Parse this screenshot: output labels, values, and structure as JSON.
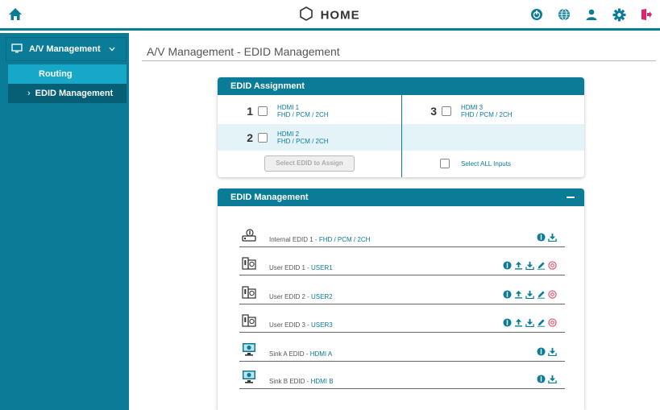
{
  "header": {
    "title": "HOME",
    "icons": [
      "home-icon",
      "power-icon",
      "globe-icon",
      "user-icon",
      "gear-icon",
      "logout-icon"
    ]
  },
  "sidebar": {
    "section_label": "A/V Management",
    "items": [
      {
        "label": "Routing",
        "active": false
      },
      {
        "label": "EDID Management",
        "active": true
      }
    ],
    "active_prefix": "›"
  },
  "main": {
    "breadcrumb": "A/V Management - EDID Management"
  },
  "assignment": {
    "title": "EDID Assignment",
    "inputs": [
      {
        "number": "1",
        "name": "HDMI 1",
        "format": "FHD / PCM / 2CH"
      },
      {
        "number": "2",
        "name": "HDMI 2",
        "format": "FHD / PCM / 2CH"
      },
      {
        "number": "3",
        "name": "HDMI 3",
        "format": "FHD / PCM / 2CH"
      }
    ],
    "select_button": "Select EDID to Assign",
    "select_all_label": "Select ALL Inputs"
  },
  "management": {
    "title": "EDID Management",
    "rows": [
      {
        "name": "Internal EDID 1 - ",
        "sub": "FHD / PCM / 2CH",
        "icon": "internal-edid-icon"
      },
      {
        "name": "User EDID 1 - ",
        "sub": "USER1",
        "icon": "user-edid-icon"
      },
      {
        "name": "User EDID 2 - ",
        "sub": "USER2",
        "icon": "user-edid-icon"
      },
      {
        "name": "User EDID 3 - ",
        "sub": "USER3",
        "icon": "user-edid-icon"
      },
      {
        "name": "Sink A EDID - ",
        "sub": "HDMI A",
        "icon": "sink-monitor-icon"
      },
      {
        "name": "Sink B EDID - ",
        "sub": "HDMI B",
        "icon": "sink-monitor-icon"
      }
    ]
  },
  "colors": {
    "accent": "#0a7c98",
    "sidebar_active": "#075f75",
    "sidebar_routing": "#17a8c7",
    "logout": "#d9266e",
    "delete": "#e0506e"
  }
}
